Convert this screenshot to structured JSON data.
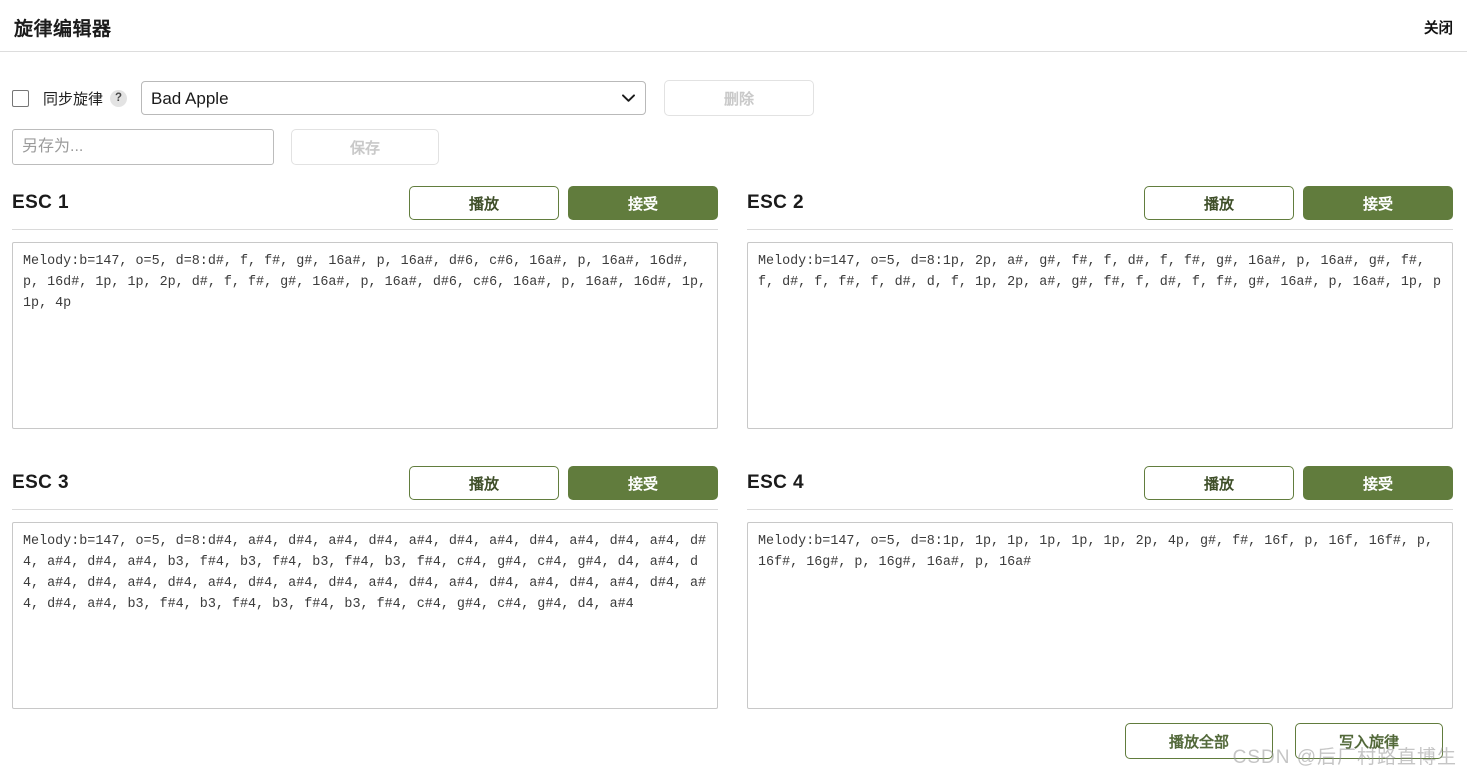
{
  "header": {
    "title": "旋律编辑器",
    "close_label": "关闭"
  },
  "toolbar": {
    "sync_checkbox_label": "同步旋律",
    "help_badge": "?",
    "melody_select_value": "Bad Apple",
    "melody_select_options": [
      "Bad Apple"
    ],
    "delete_label": "删除",
    "save_as_placeholder": "另存为...",
    "save_as_value": "",
    "save_label": "保存"
  },
  "panels": [
    {
      "title": "ESC 1",
      "play_label": "播放",
      "accept_label": "接受",
      "melody": "Melody:b=147, o=5, d=8:d#, f, f#, g#, 16a#, p, 16a#, d#6, c#6, 16a#, p, 16a#, 16d#, p, 16d#, 1p, 1p, 2p, d#, f, f#, g#, 16a#, p, 16a#, d#6, c#6, 16a#, p, 16a#, 16d#, 1p, 1p, 4p"
    },
    {
      "title": "ESC 2",
      "play_label": "播放",
      "accept_label": "接受",
      "melody": "Melody:b=147, o=5, d=8:1p, 2p, a#, g#, f#, f, d#, f, f#, g#, 16a#, p, 16a#, g#, f#, f, d#, f, f#, f, d#, d, f, 1p, 2p, a#, g#, f#, f, d#, f, f#, g#, 16a#, p, 16a#, 1p, p"
    },
    {
      "title": "ESC 3",
      "play_label": "播放",
      "accept_label": "接受",
      "melody": "Melody:b=147, o=5, d=8:d#4, a#4, d#4, a#4, d#4, a#4, d#4, a#4, d#4, a#4, d#4, a#4, d#4, a#4, d#4, a#4, b3, f#4, b3, f#4, b3, f#4, b3, f#4, c#4, g#4, c#4, g#4, d4, a#4, d4, a#4, d#4, a#4, d#4, a#4, d#4, a#4, d#4, a#4, d#4, a#4, d#4, a#4, d#4, a#4, d#4, a#4, d#4, a#4, b3, f#4, b3, f#4, b3, f#4, b3, f#4, c#4, g#4, c#4, g#4, d4, a#4"
    },
    {
      "title": "ESC 4",
      "play_label": "播放",
      "accept_label": "接受",
      "melody": "Melody:b=147, o=5, d=8:1p, 1p, 1p, 1p, 1p, 1p, 2p, 4p, g#, f#, 16f, p, 16f, 16f#, p, 16f#, 16g#, p, 16g#, 16a#, p, 16a#"
    }
  ],
  "footer": {
    "play_all_label": "播放全部",
    "write_melody_label": "写入旋律"
  },
  "watermark": {
    "text": "CSDN @后厂村路直博生"
  },
  "colors": {
    "accent_green": "#617c3d",
    "border_grey": "#c8c8c8",
    "disabled_text": "#c9c9c9"
  }
}
